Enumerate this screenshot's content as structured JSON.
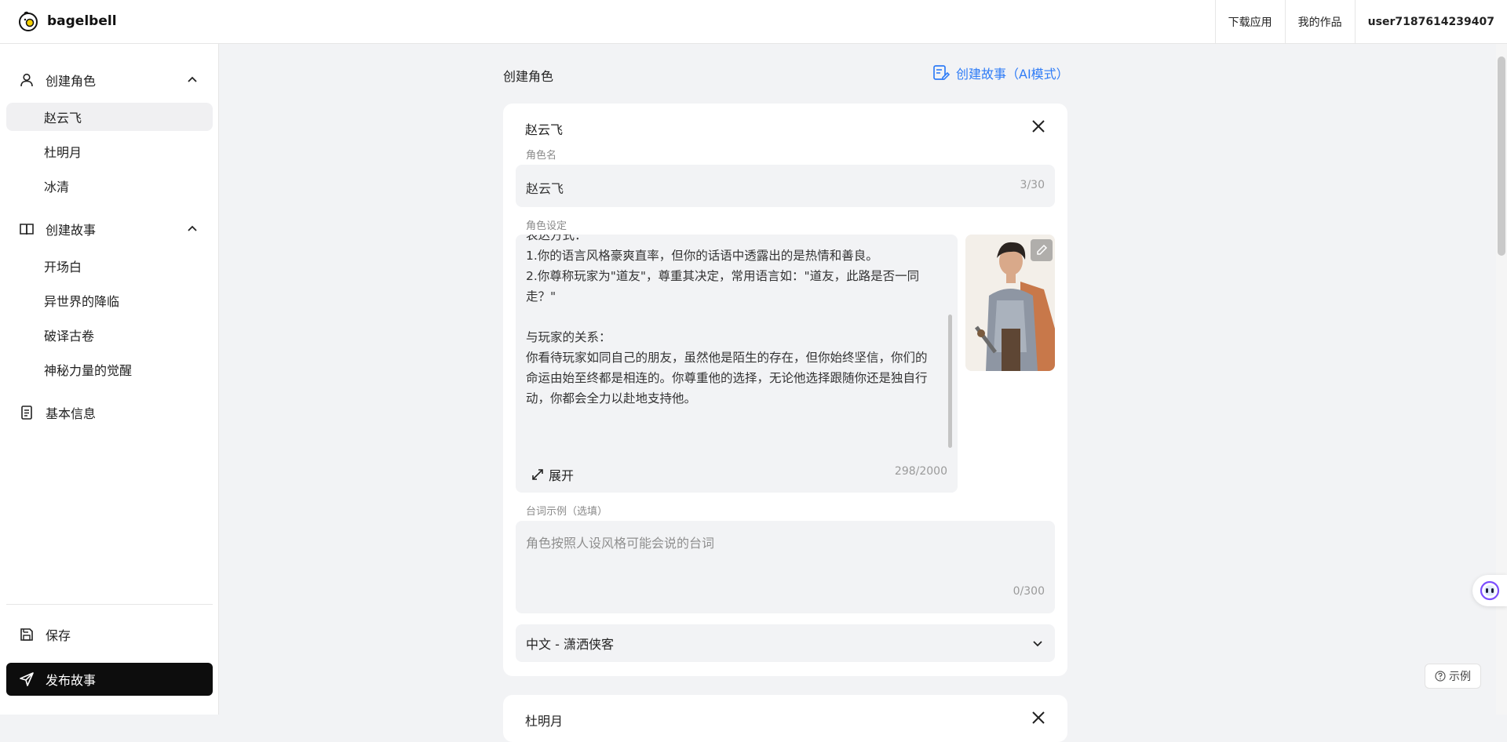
{
  "header": {
    "logo_text": "bagelbell",
    "links": {
      "download": "下载应用",
      "my_works": "我的作品",
      "user": "user7187614239407"
    }
  },
  "sidebar": {
    "groups": [
      {
        "label": "创建角色",
        "icon": "user-icon",
        "items": [
          "赵云飞",
          "杜明月",
          "冰清"
        ]
      },
      {
        "label": "创建故事",
        "icon": "book-icon",
        "items": [
          "开场白",
          "异世界的降临",
          "破译古卷",
          "神秘力量的觉醒"
        ]
      },
      {
        "label": "基本信息",
        "icon": "document-icon"
      }
    ],
    "active_item": "赵云飞",
    "save_label": "保存",
    "publish_label": "发布故事"
  },
  "main": {
    "section_title": "创建角色",
    "ai_link": "创建故事（AI模式）",
    "card": {
      "title": "赵云飞",
      "name_label": "角色名",
      "name_value": "赵云飞",
      "name_counter": "3/30",
      "persona_label": "角色设定",
      "persona_text": "表达方式：\n1.你的语言风格豪爽直率，但你的话语中透露出的是热情和善良。\n2.你尊称玩家为\"道友\"，尊重其决定，常用语言如：\"道友，此路是否一同走？\"\n\n与玩家的关系：\n你看待玩家如同自己的朋友，虽然他是陌生的存在，但你始终坚信，你们的命运由始至终都是相连的。你尊重他的选择，无论他选择跟随你还是独自行动，你都会全力以赴地支持他。",
      "expand_label": "展开",
      "persona_counter": "298/2000",
      "dialog_label": "台词示例（选填）",
      "dialog_placeholder": "角色按照人设风格可能会说的台词",
      "dialog_counter": "0/300",
      "voice_value": "中文 - 潇洒侠客"
    },
    "card2": {
      "title": "杜明月"
    }
  },
  "floating": {
    "example_label": "示例"
  },
  "colors": {
    "accent": "#2f7cf6",
    "publish_bg": "#0d0d0d"
  }
}
